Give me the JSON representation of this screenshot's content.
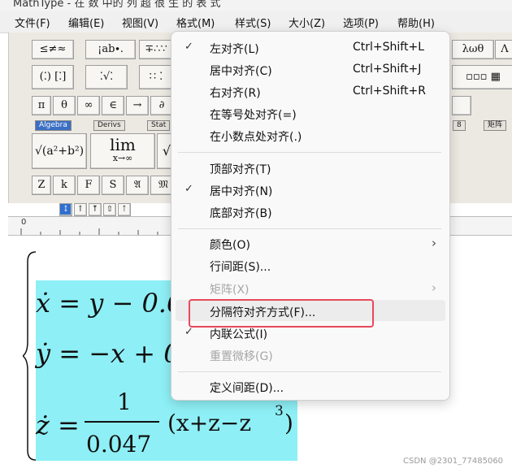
{
  "window": {
    "title": "MathType - 在 数 中的 列 超 很 生 的 表 式"
  },
  "menubar": {
    "items": [
      "文件(F)",
      "编辑(E)",
      "视图(V)",
      "格式(M)",
      "样式(S)",
      "大小(Z)",
      "选项(P)",
      "帮助(H)"
    ]
  },
  "toolbar": {
    "row1": [
      "≤≠≈",
      "¡ab∙.",
      "∓∴∵",
      "λωθ",
      "Λ"
    ],
    "row2": [
      "(⁚) [⁚]",
      "⁚√⁚",
      "∷ ⁚",
      "▫▫▫ ▦"
    ],
    "row3": [
      "π",
      "θ",
      "∞",
      "∈",
      "→",
      "∂"
    ],
    "tabs": [
      "Algebra",
      "Derivs",
      "Stat",
      "8",
      "矩阵"
    ],
    "row4": [
      "√(a²+b²)",
      "lim x→∞",
      "√"
    ],
    "row4_lim": "lim",
    "row4_sub": "x→∞",
    "row5": [
      "Z",
      "k",
      "F",
      "S",
      "𝔄",
      "𝔐"
    ],
    "alignbar": [
      "↕",
      "↑",
      "⤒",
      "⇧",
      "⇡"
    ]
  },
  "ruler": {
    "zero_label": "0"
  },
  "editor": {
    "eq1": "ẋ = y − 0.6",
    "eq2": "ẏ = −x + 0",
    "eq3_lhs": "ż =",
    "eq3_num": "1",
    "eq3_den": "0.047",
    "eq3_rhs": "(x+z−z",
    "eq3_exp": "3",
    "eq3_close": ")"
  },
  "format_menu": {
    "items": [
      {
        "label": "左对齐(L)",
        "shortcut": "Ctrl+Shift+L",
        "checked": true,
        "enabled": true
      },
      {
        "label": "居中对齐(C)",
        "shortcut": "Ctrl+Shift+J",
        "checked": false,
        "enabled": true
      },
      {
        "label": "右对齐(R)",
        "shortcut": "Ctrl+Shift+R",
        "checked": false,
        "enabled": true
      },
      {
        "label": "在等号处对齐(=)",
        "shortcut": "",
        "checked": false,
        "enabled": true
      },
      {
        "label": "在小数点处对齐(.)",
        "shortcut": "",
        "checked": false,
        "enabled": true
      },
      {
        "label": "顶部对齐(T)",
        "shortcut": "",
        "checked": false,
        "enabled": true
      },
      {
        "label": "居中对齐(N)",
        "shortcut": "",
        "checked": true,
        "enabled": true
      },
      {
        "label": "底部对齐(B)",
        "shortcut": "",
        "checked": false,
        "enabled": true
      },
      {
        "label": "颜色(O)",
        "shortcut": "",
        "checked": false,
        "enabled": true,
        "submenu": true
      },
      {
        "label": "行间距(S)...",
        "shortcut": "",
        "checked": false,
        "enabled": true
      },
      {
        "label": "矩阵(X)",
        "shortcut": "",
        "checked": false,
        "enabled": false,
        "submenu": true
      },
      {
        "label": "分隔符对齐方式(F)...",
        "shortcut": "",
        "checked": false,
        "enabled": true,
        "highlighted": true
      },
      {
        "label": "内联公式(I)",
        "shortcut": "",
        "checked": true,
        "enabled": true
      },
      {
        "label": "重置微移(G)",
        "shortcut": "",
        "checked": false,
        "enabled": false
      },
      {
        "label": "定义间距(D)...",
        "shortcut": "",
        "checked": false,
        "enabled": true
      }
    ],
    "check_glyph": "✓",
    "arrow_glyph": "›"
  },
  "colors": {
    "highlight": "#8ef0f6",
    "annotation": "#e8485a",
    "active_tab": "#3a6fc4"
  },
  "watermark": "CSDN @2301_77485060"
}
